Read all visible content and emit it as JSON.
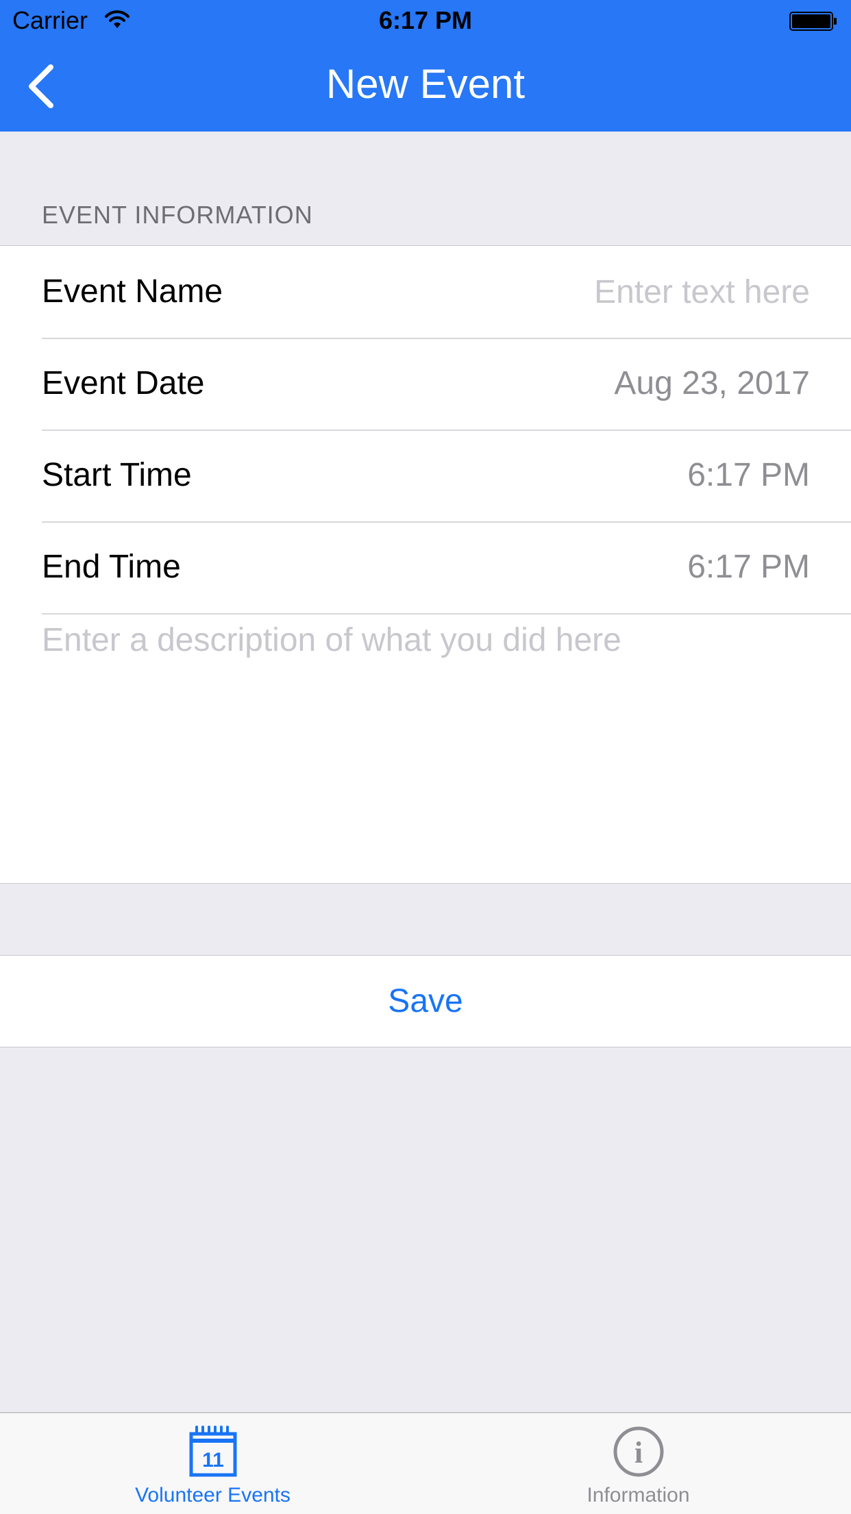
{
  "status_bar": {
    "carrier": "Carrier",
    "time": "6:17 PM",
    "wifi_icon": "wifi-icon",
    "battery_icon": "battery-icon"
  },
  "nav": {
    "title": "New Event",
    "back_icon": "chevron-left-icon",
    "background_color": "#2777F6"
  },
  "section": {
    "header": "EVENT INFORMATION"
  },
  "form": {
    "event_name": {
      "label": "Event Name",
      "value": "",
      "placeholder": "Enter text here"
    },
    "event_date": {
      "label": "Event Date",
      "value": "Aug 23, 2017"
    },
    "start_time": {
      "label": "Start Time",
      "value": "6:17 PM"
    },
    "end_time": {
      "label": "End Time",
      "value": "6:17 PM"
    },
    "description": {
      "value": "",
      "placeholder": "Enter a description of what you did here"
    }
  },
  "actions": {
    "save_label": "Save"
  },
  "tab_bar": {
    "tabs": [
      {
        "label": "Volunteer Events",
        "icon": "calendar-icon",
        "icon_text": "11",
        "active": true
      },
      {
        "label": "Information",
        "icon": "info-icon",
        "icon_text": "i",
        "active": false
      }
    ],
    "active_color": "#1874F5",
    "inactive_color": "#8E8E93"
  }
}
